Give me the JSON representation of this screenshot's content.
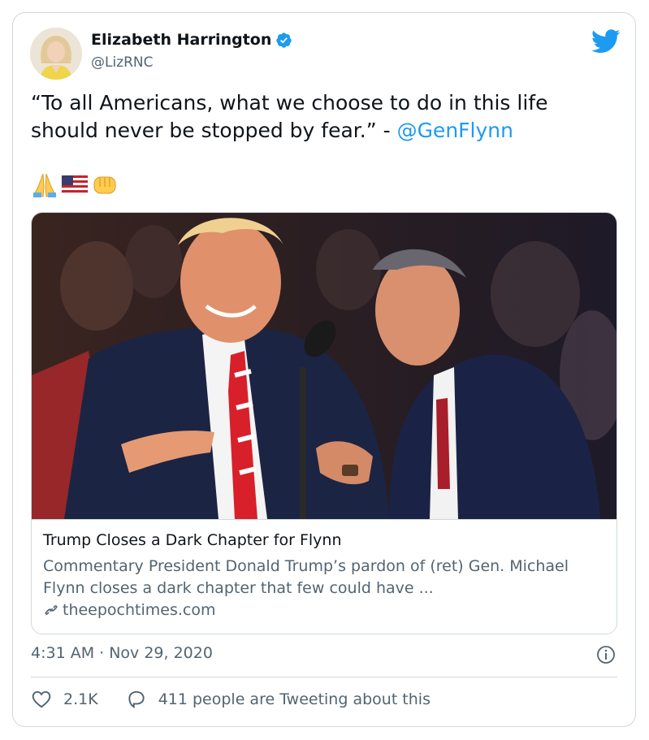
{
  "author": {
    "display_name": "Elizabeth Harrington",
    "handle": "@LizRNC"
  },
  "tweet": {
    "text_before_mention": "“To all Americans, what we choose to do in this life should never be stopped by fear.” - ",
    "mention": "@GenFlynn",
    "emojis": [
      "folded-hands",
      "us-flag",
      "oncoming-fist"
    ]
  },
  "link_card": {
    "title": "Trump Closes a Dark Chapter for Flynn",
    "description": "Commentary President Donald Trump’s pardon of (ret) Gen. Michael Flynn closes a dark chapter that few could have ...",
    "domain": "theepochtimes.com"
  },
  "timestamp": "4:31 AM · Nov 29, 2020",
  "stats": {
    "likes": "2.1K",
    "tweeting_about": "411 people are Tweeting about this"
  },
  "colors": {
    "accent": "#1d9bf0",
    "text": "#0f1419",
    "secondary_text": "#536471",
    "border": "#cfd9de"
  },
  "icons": [
    "verified-icon",
    "twitter-logo-icon",
    "link-icon",
    "info-icon",
    "heart-icon",
    "reply-bubble-icon"
  ]
}
